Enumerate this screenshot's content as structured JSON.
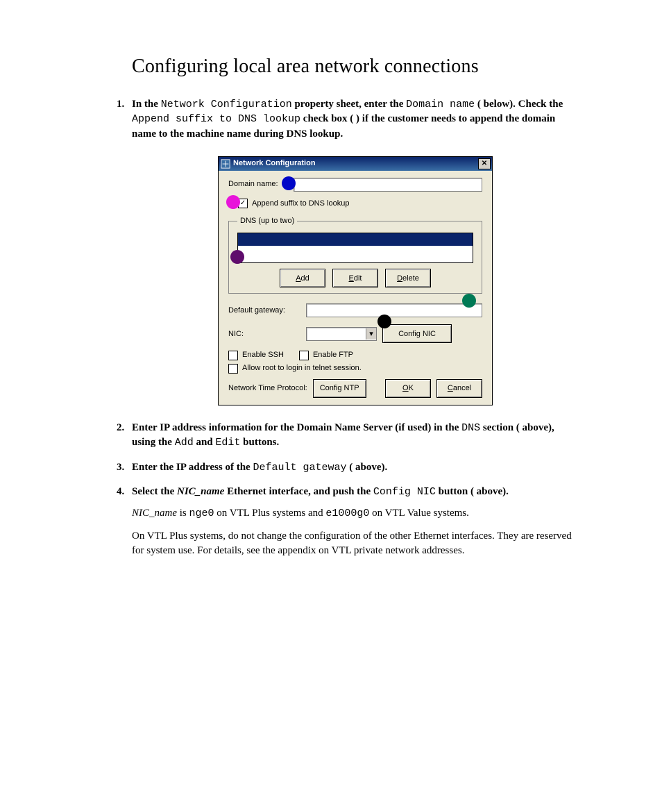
{
  "page": {
    "heading": "Configuring local area network connections"
  },
  "steps": {
    "s1": {
      "num": "1.",
      "t1": "In the ",
      "t2": "Network Configuration",
      "t3": " property sheet, enter the ",
      "t4": "Domain name",
      "t5": " (   below). Check the ",
      "t6": "Append suffix to DNS lookup",
      "t7": " check box (   ) if the customer needs to append the domain name to the machine name during DNS lookup."
    },
    "s2": {
      "num": "2.",
      "t1": "Enter IP address information for the Domain Name Server (if used) in the ",
      "t2": "DNS",
      "t3": " section (   above), using the ",
      "t4": "Add",
      "t5": " and ",
      "t6": "Edit",
      "t7": " buttons."
    },
    "s3": {
      "num": "3.",
      "t1": "Enter the IP address of the ",
      "t2": "Default gateway",
      "t3": " (   above)."
    },
    "s4": {
      "num": "4.",
      "t1": "Select the ",
      "t2": "NIC_name",
      "t3": " Ethernet interface, and push the ",
      "t4": "Config NIC",
      "t5": " button (   above)."
    }
  },
  "body": {
    "p1a": "NIC_name",
    "p1b": " is ",
    "p1c": "nge0",
    "p1d": " on VTL Plus systems and ",
    "p1e": "e1000g0",
    "p1f": " on VTL Value systems.",
    "p2": "On VTL Plus systems, do not change the configuration of the other Ethernet interfaces. They are reserved for system use. For details, see the appendix on VTL private network addresses."
  },
  "dialog": {
    "title": "Network Configuration",
    "domain_label": "Domain name:",
    "domain_value": "",
    "append_label": "Append suffix to DNS lookup",
    "append_checked": true,
    "dns_legend": "DNS (up to two)",
    "btn_add": "Add",
    "btn_add_ul": "A",
    "btn_edit": "Edit",
    "btn_edit_ul": "E",
    "btn_delete": "Delete",
    "btn_delete_ul": "D",
    "gateway_label": "Default gateway:",
    "gateway_value": "",
    "nic_label": "NIC:",
    "nic_value": "",
    "btn_config_nic": "Config NIC",
    "chk_ssh": "Enable SSH",
    "chk_ftp": "Enable FTP",
    "chk_root": "Allow root to login in telnet session.",
    "ntp_label": "Network Time Protocol:",
    "btn_config_ntp": "Config NTP",
    "btn_ok": "OK",
    "btn_ok_ul": "O",
    "btn_cancel": "Cancel",
    "btn_cancel_ul": "C"
  }
}
